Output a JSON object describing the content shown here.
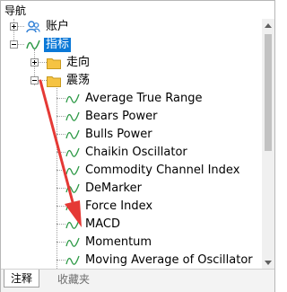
{
  "panel": {
    "title": "导航"
  },
  "tree": {
    "accounts_label": "账户",
    "indicators_label": "指标",
    "trend_label": "走向",
    "oscillators_label": "震荡",
    "items": [
      {
        "label": "Average True Range"
      },
      {
        "label": "Bears Power"
      },
      {
        "label": "Bulls Power"
      },
      {
        "label": "Chaikin Oscillator"
      },
      {
        "label": "Commodity Channel Index"
      },
      {
        "label": "DeMarker"
      },
      {
        "label": "Force Index"
      },
      {
        "label": "MACD"
      },
      {
        "label": "Momentum"
      },
      {
        "label": "Moving Average of Oscillator"
      }
    ]
  },
  "tabs": [
    {
      "label": "注释"
    },
    {
      "label": "收藏夹"
    }
  ],
  "colors": {
    "selection": "#0a78d7",
    "indicator_icon": "#2e9a47",
    "folder": "#f5c342",
    "accounts_icon": "#2f7fd6",
    "annotation_arrow": "#e53935"
  }
}
